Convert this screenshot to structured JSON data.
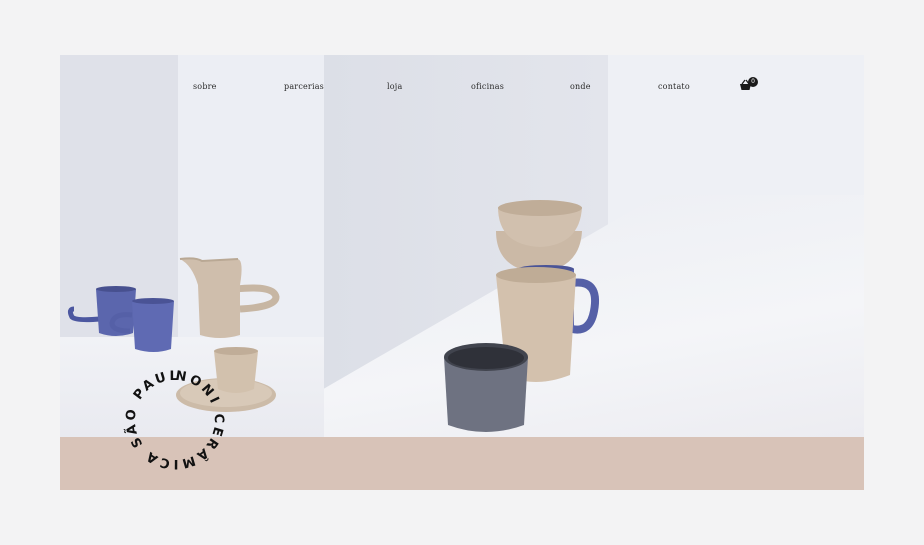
{
  "nav": {
    "items": [
      "sobre",
      "parcerias",
      "loja",
      "oficinas",
      "onde",
      "contato"
    ]
  },
  "cart": {
    "count": "0",
    "icon": "shopping-basket-icon"
  },
  "brand": {
    "ring_text": "NONI CERÂMICA SÃO PAULO"
  },
  "colors": {
    "blue_glaze": "#5b66ad",
    "sand_glaze": "#cdbcaa",
    "grey_glaze": "#6e7281",
    "footer_band": "#d8c3b8"
  }
}
